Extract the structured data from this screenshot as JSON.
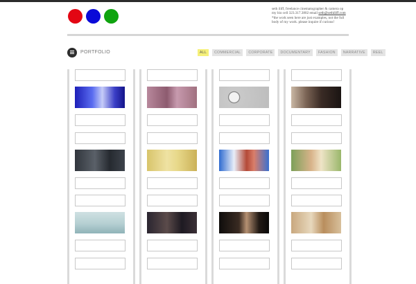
{
  "header": {
    "bio_line1": "seth iliff, freelance cinematographer & camera op",
    "bio_line2_prefix": "my bio cell 323.317.3802 email ",
    "bio_email": "seth@sethiliff.com",
    "bio_line3": "*the work seen here are just examples, not the full",
    "bio_line4": "body of my work. please inquire if curious!"
  },
  "portfolio": {
    "label": "PORTFOLIO",
    "filters": [
      {
        "label": "ALL",
        "active": true
      },
      {
        "label": "COMMERCIAL",
        "active": false
      },
      {
        "label": "CORPORATE",
        "active": false
      },
      {
        "label": "DOCUMENTARY",
        "active": false
      },
      {
        "label": "FASHION",
        "active": false
      },
      {
        "label": "NARRATIVE",
        "active": false
      },
      {
        "label": "REEL",
        "active": false
      }
    ]
  },
  "colors": {
    "red_circle": "#e30613",
    "blue_circle": "#0a0ad8",
    "green_circle": "#0fa30f",
    "active_filter": "#f5f07a"
  },
  "thumbnails": [
    {
      "name": "thumb-blue-figure",
      "bg": "linear-gradient(90deg,#1d1fb8 0%,#5a6cf0 35%,#c6ccf8 55%,#3a3ec6 80%,#14148a 100%)"
    },
    {
      "name": "thumb-pink-portrait",
      "bg": "linear-gradient(90deg,#b8889c 0%,#8d5b6f 40%,#c79aae 60%,#a0707f 100%)"
    },
    {
      "name": "thumb-wall-clock",
      "bg": "radial-gradient(circle at 30% 50%,#f2f2f2 0 7px,#6f6f6f 8px,#c9c9c9 9px,#bdbdbd 100%)"
    },
    {
      "name": "thumb-woman-dark",
      "bg": "linear-gradient(90deg,#c9b7a4 0%,#7b6455 30%,#3a2b25 60%,#1a1412 100%)"
    },
    {
      "name": "thumb-couple-bed",
      "bg": "linear-gradient(90deg,#31363d 0%,#5a6068 40%,#262a30 70%,#3d434b 100%)"
    },
    {
      "name": "thumb-yellow-car",
      "bg": "linear-gradient(90deg,#d8c46a 0%,#efe2a3 40%,#e8d98b 60%,#cbb158 100%)"
    },
    {
      "name": "thumb-man-sunglasses",
      "bg": "linear-gradient(90deg,#2f6bd0 0%,#e8eef8 30%,#b44a38 55%,#d97e6a 70%,#3a70d0 100%)"
    },
    {
      "name": "thumb-man-lawn",
      "bg": "linear-gradient(90deg,#7da05a 0%,#d8b38a 40%,#efe4c7 60%,#9ab76b 100%)"
    },
    {
      "name": "thumb-helicopter",
      "bg": "linear-gradient(180deg,#cfe1e3 0%,#b5cfd2 55%,#8fb3b8 100%)"
    },
    {
      "name": "thumb-woman-portrait",
      "bg": "linear-gradient(90deg,#2a2530 0%,#5b4b4a 40%,#1e1a22 70%,#3b3036 100%)"
    },
    {
      "name": "thumb-hands-dark",
      "bg": "linear-gradient(90deg,#0f0d0c 0%,#3a2b22 40%,#b59072 55%,#221a15 80%,#0a0908 100%)"
    },
    {
      "name": "thumb-blonde-woman",
      "bg": "linear-gradient(90deg,#c9a87e 0%,#e7d8bd 40%,#b98e5d 65%,#d8c09c 100%)"
    }
  ]
}
